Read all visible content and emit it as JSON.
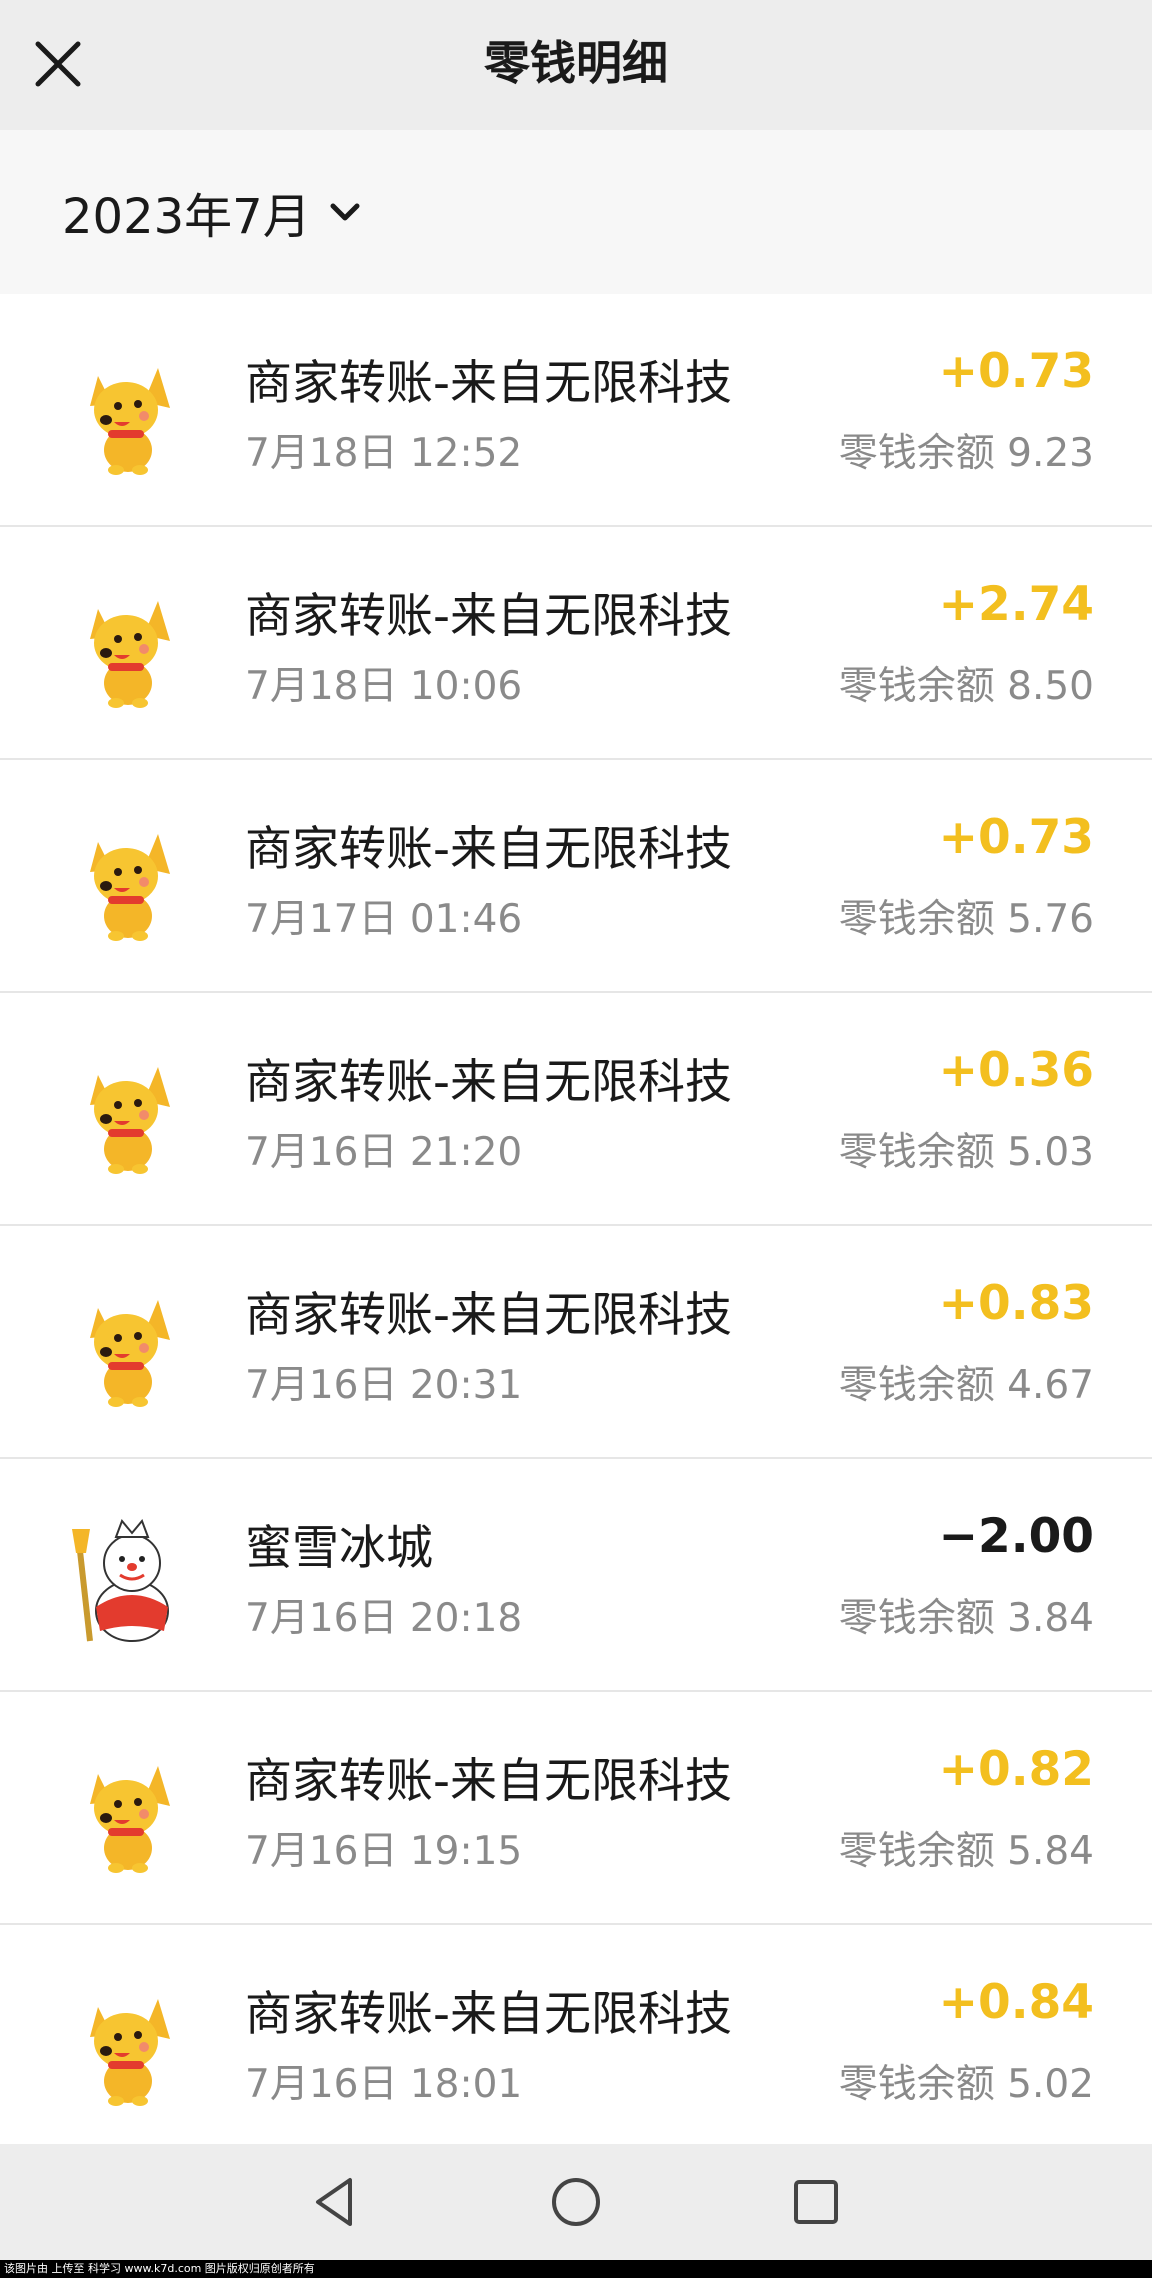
{
  "header": {
    "title": "零钱明细",
    "close_icon": "close-icon"
  },
  "month_filter": {
    "label": "2023年7月",
    "icon": "chevron-down-icon"
  },
  "colors": {
    "income": "#f3bf1f",
    "expense": "#1a1a1a",
    "secondary_text": "#8a8a8a"
  },
  "transactions": [
    {
      "title": "商家转账-来自无限科技",
      "time": "7月18日 12:52",
      "amount": "+0.73",
      "balance": "零钱余额 9.23",
      "icon": "dog-mascot-icon",
      "type": "income"
    },
    {
      "title": "商家转账-来自无限科技",
      "time": "7月18日 10:06",
      "amount": "+2.74",
      "balance": "零钱余额 8.50",
      "icon": "dog-mascot-icon",
      "type": "income"
    },
    {
      "title": "商家转账-来自无限科技",
      "time": "7月17日 01:46",
      "amount": "+0.73",
      "balance": "零钱余额 5.76",
      "icon": "dog-mascot-icon",
      "type": "income"
    },
    {
      "title": "商家转账-来自无限科技",
      "time": "7月16日 21:20",
      "amount": "+0.36",
      "balance": "零钱余额 5.03",
      "icon": "dog-mascot-icon",
      "type": "income"
    },
    {
      "title": "商家转账-来自无限科技",
      "time": "7月16日 20:31",
      "amount": "+0.83",
      "balance": "零钱余额 4.67",
      "icon": "dog-mascot-icon",
      "type": "income"
    },
    {
      "title": "蜜雪冰城",
      "time": "7月16日 20:18",
      "amount": "−2.00",
      "balance": "零钱余额 3.84",
      "icon": "snowman-mascot-icon",
      "type": "expense"
    },
    {
      "title": "商家转账-来自无限科技",
      "time": "7月16日 19:15",
      "amount": "+0.82",
      "balance": "零钱余额 5.84",
      "icon": "dog-mascot-icon",
      "type": "income"
    },
    {
      "title": "商家转账-来自无限科技",
      "time": "7月16日 18:01",
      "amount": "+0.84",
      "balance": "零钱余额 5.02",
      "icon": "dog-mascot-icon",
      "type": "income"
    }
  ],
  "navigation": {
    "back_icon": "back-triangle-icon",
    "home_icon": "home-circle-icon",
    "recents_icon": "recents-square-icon"
  },
  "watermark": "该图片由 上传至 科学习 www.k7d.com 图片版权归原创者所有"
}
